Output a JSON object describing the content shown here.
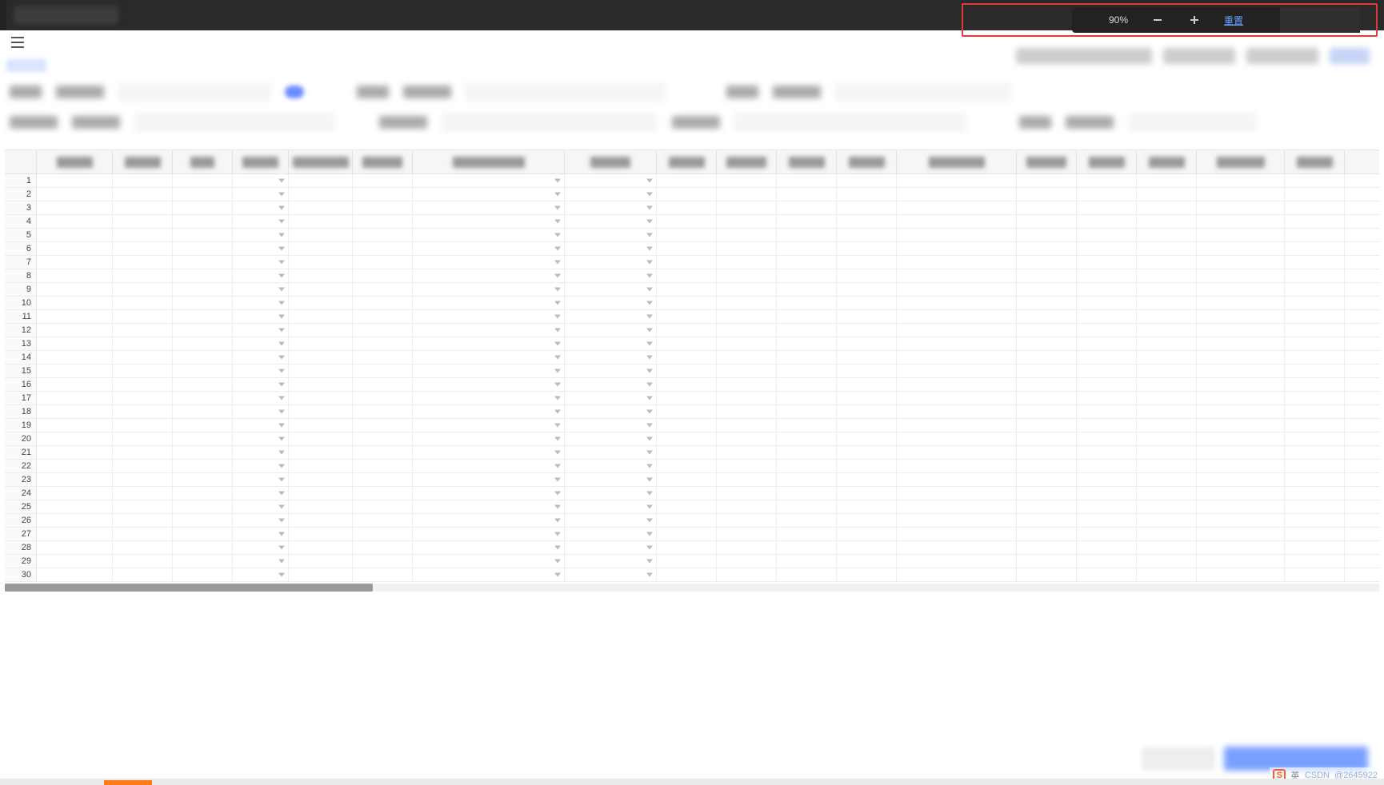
{
  "zoom": {
    "level": "90%",
    "reset_label": "重置"
  },
  "grid": {
    "row_count": 30,
    "dropdown_cols": [
      3,
      6,
      7
    ],
    "col_classes": [
      "cA",
      "cB",
      "cC",
      "cD",
      "cE",
      "cF",
      "cG",
      "cH",
      "cI",
      "cJ",
      "cK",
      "cL",
      "cM",
      "cN",
      "cO",
      "cP",
      "cQ",
      "cR"
    ],
    "header_blur_widths": [
      45,
      45,
      30,
      45,
      70,
      50,
      90,
      50,
      45,
      50,
      45,
      45,
      70,
      50,
      45,
      45,
      60,
      45
    ]
  },
  "ime": {
    "lang": "英",
    "brand_hint": "CSDN",
    "extra": "@2645922"
  }
}
